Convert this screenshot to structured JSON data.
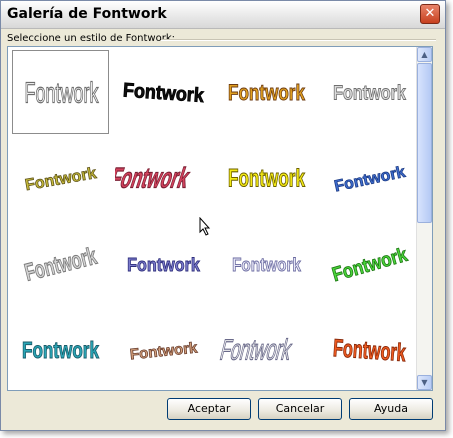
{
  "window": {
    "title": "Galería de Fontwork"
  },
  "gallery": {
    "caption": "Seleccione un estilo de Fontwork:",
    "styles": [
      {
        "label": "Fontwork",
        "fill": "#ffffff",
        "stroke": "#6c6c6c"
      },
      {
        "label": "Fontwork",
        "fill": "#101010",
        "stroke": "#000000"
      },
      {
        "label": "Fontwork",
        "fill": "#e0a020",
        "stroke": "#6b3a12"
      },
      {
        "label": "Fontwork",
        "fill": "#dcdcdc",
        "stroke": "#6f6f6f"
      },
      {
        "label": "Fontwork",
        "fill": "#c8bd3c",
        "stroke": "#5f5418"
      },
      {
        "label": "Fontwork",
        "fill": "#d2425c",
        "stroke": "#7a1f33"
      },
      {
        "label": "Fontwork",
        "fill": "#f4ea14",
        "stroke": "#6b6000"
      },
      {
        "label": "Fontwork",
        "fill": "#3f6ed0",
        "stroke": "#1c3b85"
      },
      {
        "label": "Fontwork",
        "fill": "#d4d4d4",
        "stroke": "#7a7a7a"
      },
      {
        "label": "Fontwork",
        "fill": "#7c7ccc",
        "stroke": "#2e2e7c"
      },
      {
        "label": "Fontwork",
        "fill": "#e6e6f6",
        "stroke": "#6a6aa0"
      },
      {
        "label": "Fontwork",
        "fill": "#4ad43a",
        "stroke": "#1e7a14"
      },
      {
        "label": "Fontwork",
        "fill": "#2aa6b6",
        "stroke": "#1b5c6a"
      },
      {
        "label": "Fontwork",
        "fill": "#d4a07c",
        "stroke": "#6b4030"
      },
      {
        "label": "Fontwork",
        "fill": "#f2f2f2",
        "stroke": "#6a6a8a"
      },
      {
        "label": "Fontwork",
        "fill": "#ee5a20",
        "stroke": "#8a2a0a"
      }
    ]
  },
  "buttons": {
    "ok": "Aceptar",
    "cancel": "Cancelar",
    "help": "Ayuda"
  },
  "icons": {
    "close": "close-icon",
    "scroll_up": "arrow-up-icon",
    "scroll_down": "arrow-down-icon",
    "cursor": "mouse-pointer-icon"
  }
}
